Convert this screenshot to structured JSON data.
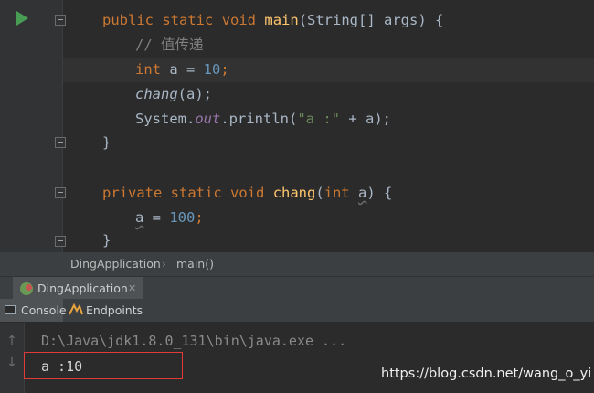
{
  "editor": {
    "main_signature": {
      "kw1": "public",
      "kw2": "static",
      "kw3": "void",
      "name": "main",
      "params": "(String[] args) {"
    },
    "comment": "// 值传递",
    "decl": {
      "type": "int",
      "rest_a": " a = ",
      "value": "10",
      "end": ";"
    },
    "call": {
      "name": "chang",
      "args": "(a);"
    },
    "println": {
      "cls": "System.",
      "field": "out",
      "method": ".println(",
      "str": "\"a :\"",
      "rest": " + a);"
    },
    "close1": "}",
    "chang_signature": {
      "kw1": "private",
      "kw2": "static",
      "kw3": "void",
      "name": "chang",
      "open": "(",
      "ptype": "int",
      "pname": "a",
      "close": ") {"
    },
    "assign": {
      "var": "a",
      "rest": " = ",
      "value": "100",
      "end": ";"
    },
    "close2": "}"
  },
  "breadcrumb": {
    "class_name": "DingApplication",
    "separator": "›",
    "method": "main()"
  },
  "run_panel": {
    "tab_label": "DingApplication",
    "tab_close": "✕"
  },
  "tool_tabs": {
    "console": "Console",
    "endpoints": "Endpoints"
  },
  "console": {
    "up_arrow": "↑",
    "down_arrow": "↓",
    "command": "D:\\Java\\jdk1.8.0_131\\bin\\java.exe ...",
    "output": "a :10"
  },
  "watermark": "https://blog.csdn.net/wang_o_yi",
  "icons": {
    "run": "run-icon",
    "fold": "fold-icon",
    "console": "console-icon",
    "endpoints": "endpoints-icon",
    "spring": "spring-boot-icon"
  },
  "colors": {
    "keyword": "#cc7832",
    "function": "#ffc66d",
    "number": "#6897bb",
    "string": "#6a8759",
    "comment": "#808080",
    "field": "#9876aa",
    "highlight_box": "#e03a3a"
  }
}
